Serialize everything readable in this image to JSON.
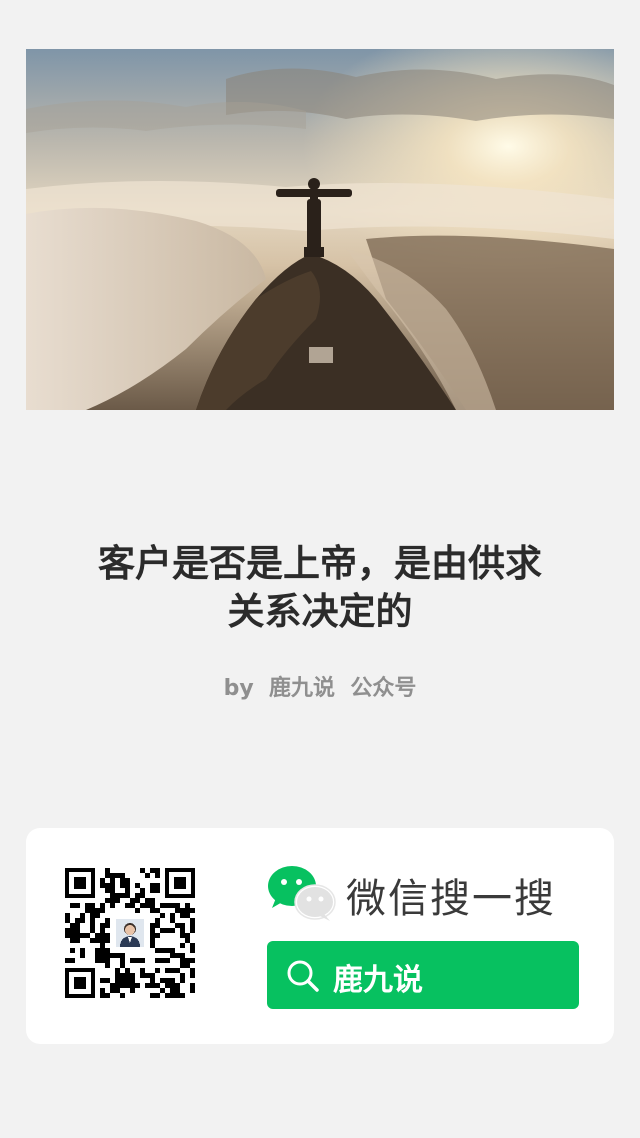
{
  "article": {
    "title_line1": "客户是否是上帝，是由供求",
    "title_line2": "关系决定的",
    "byline": "by  鹿九说  公众号"
  },
  "wechat_card": {
    "search_title": "微信搜一搜",
    "search_keyword": "鹿九说",
    "accent_color": "#07c160",
    "icons": [
      "qr-code-icon",
      "wechat-logo-icon",
      "search-icon"
    ]
  }
}
